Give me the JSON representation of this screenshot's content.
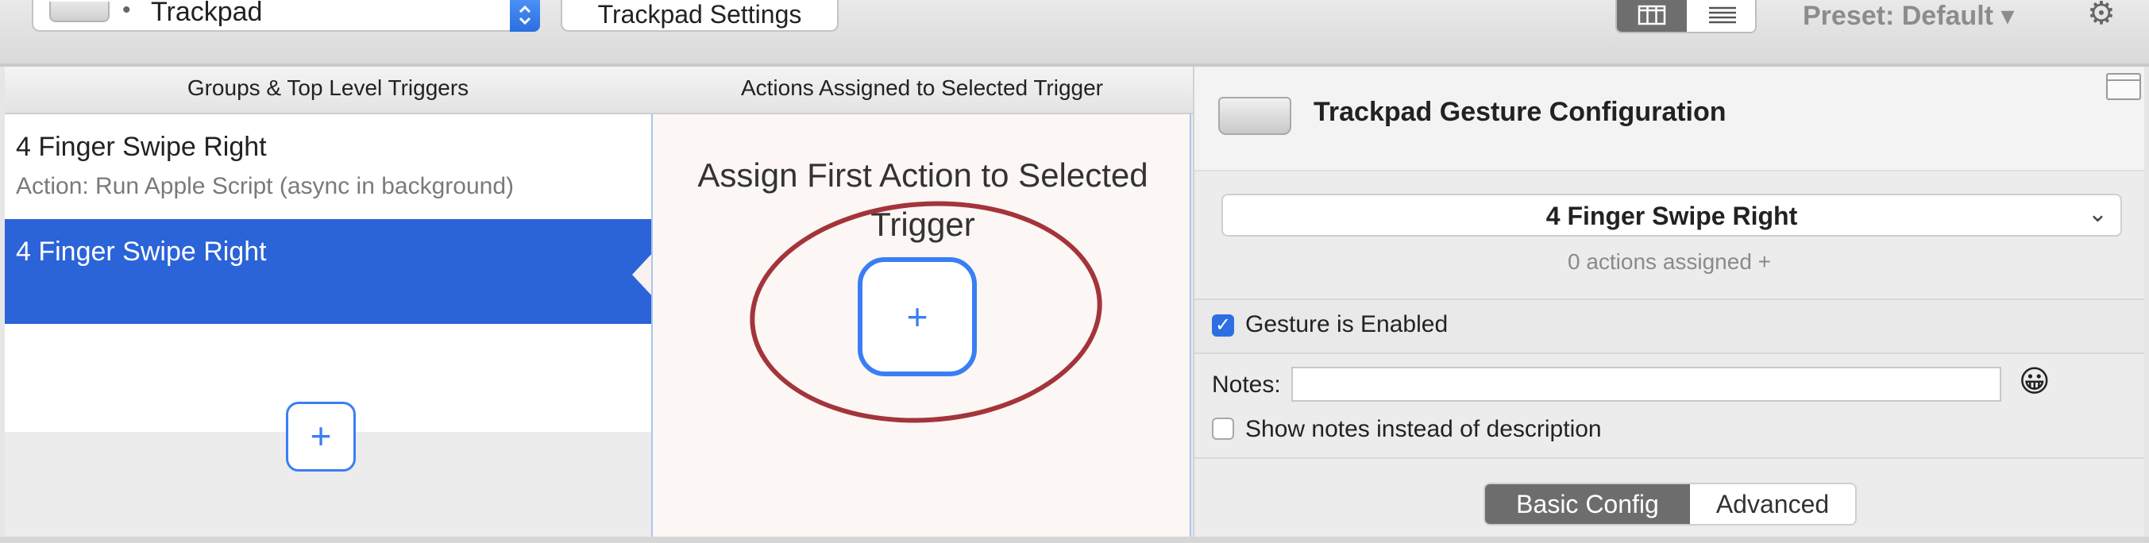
{
  "toolbar": {
    "device_label": "Trackpad",
    "device_bullet": "•",
    "stepper_icon": "up-down-arrows",
    "settings_button": "Trackpad Settings",
    "preset_label": "Preset: Default ▾",
    "gear_icon": "⚙"
  },
  "left_panel": {
    "header": "Groups & Top Level Triggers",
    "triggers": [
      {
        "title": "4 Finger Swipe Right",
        "subtitle": "Action: Run Apple Script (async in background)"
      },
      {
        "title": "4 Finger Swipe Right",
        "subtitle": ""
      }
    ],
    "add_label": "+"
  },
  "middle_panel": {
    "header": "Actions Assigned to Selected Trigger",
    "assign_text": "Assign First Action to Selected Trigger",
    "add_label": "+"
  },
  "right_panel": {
    "title": "Trackpad Gesture Configuration",
    "selected_gesture": "4 Finger Swipe Right",
    "chevron": "⌄",
    "actions_assigned": "0 actions assigned +",
    "gesture_enabled_label": "Gesture is Enabled",
    "gesture_enabled_check": "✓",
    "notes_label": "Notes:",
    "notes_value": "",
    "emoji": "😀",
    "show_notes_label": "Show notes instead of description",
    "tabs": [
      "Basic Config",
      "Advanced"
    ]
  },
  "colors": {
    "selection_blue": "#2b63d8",
    "accent_blue": "#3a7ef4",
    "annotation_red": "#a3353a"
  }
}
